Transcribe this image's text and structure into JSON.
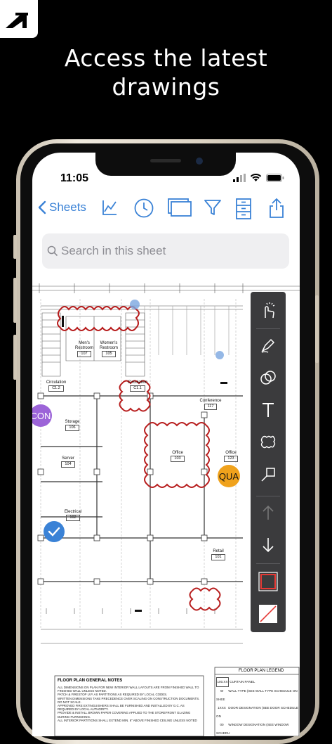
{
  "headline": {
    "line1": "Access the latest",
    "line2": "drawings"
  },
  "status_bar": {
    "time": "11:05",
    "icons": [
      "signal-icon",
      "wifi-icon",
      "battery-icon"
    ]
  },
  "toolbar": {
    "back_label": "Sheets",
    "icons": [
      "chart-icon",
      "clock-icon",
      "sheets-compare-icon",
      "filter-icon",
      "cabinet-icon",
      "share-icon"
    ]
  },
  "search": {
    "placeholder": "Search in this sheet"
  },
  "drawing": {
    "rooms": [
      {
        "name": "Men's Restroom",
        "num": "107"
      },
      {
        "name": "Women's Restroom",
        "num": "105"
      },
      {
        "name": "Circulation",
        "num": "C1.2"
      },
      {
        "name": "Circulation",
        "num": "C1.1"
      },
      {
        "name": "Conference",
        "num": "117"
      },
      {
        "name": "Storage",
        "num": "106"
      },
      {
        "name": "Server",
        "num": "104"
      },
      {
        "name": "Office",
        "num": "103"
      },
      {
        "name": "Office",
        "num": "123"
      },
      {
        "name": "Electrical",
        "num": "102"
      },
      {
        "name": "Retail",
        "num": "101"
      }
    ],
    "markup_badges": {
      "con": "CON",
      "qua": "QUA"
    },
    "notes": {
      "general_title": "FLOOR PLAN GENERAL NOTES",
      "legend_title": "FLOOR PLAN LEGEND",
      "general_items": [
        "ALL DIMENSIONS ON PLAN FOR NEW INTERIOR WALL LAYOUTS ARE FROM FINISHED WALL TO FINISHED WALL UNLESS NOTED.",
        "PATCH & FIRESTOP U.P. AS PARTITIONS AS REQUIRED BY LOCAL CODES.",
        "WRITTEN DIMENSIONS TAKE PRECEDENCE OVER SCALING ON CONSTRUCTION DOCUMENTS. DO NOT SCALE.",
        "APPROVED FIRE EXTINGUISHERS SHALL BE FURNISHED AND INSTALLED BY G.C. AS REQUIRED BY LOCAL AUTHORITY.",
        "PROVIDE & INSTALL BROWN PAPER COVERING APPLIED TO THE STOREFRONT GLAZING DURING FURNISHING.",
        "ALL INTERIOR PARTITIONS SHALL EXTEND MIN. 6\" ABOVE FINISHED CEILING UNLESS NOTED"
      ],
      "legend_items": [
        {
          "code": "100.XX",
          "label": "CURTAIN PANEL"
        },
        {
          "code": "W",
          "label": "WALL TYPE (SEE WALL TYPE SCHEDULE ON SHEE"
        },
        {
          "code": "1XXX",
          "label": "DOOR DESIGNATION (SEE DOOR SCHEDULE ON"
        },
        {
          "code": "00",
          "label": "WINDOW DESIGNATION (SEE WINDOW SCHEDU"
        }
      ]
    }
  },
  "markup_tools": [
    "select-tool-icon",
    "pen-tool-icon",
    "shape-tool-icon",
    "text-tool-icon",
    "cloud-tool-icon",
    "callout-tool-icon",
    "arrow-up-icon",
    "arrow-down-icon",
    "color-swatch-red",
    "color-swatch-none"
  ],
  "colors": {
    "accent": "#3a82d6",
    "markup_red": "#b71c1c",
    "con_badge": "#9c64d8",
    "qua_badge": "#f0a21c",
    "check_badge": "#3a82d6"
  }
}
